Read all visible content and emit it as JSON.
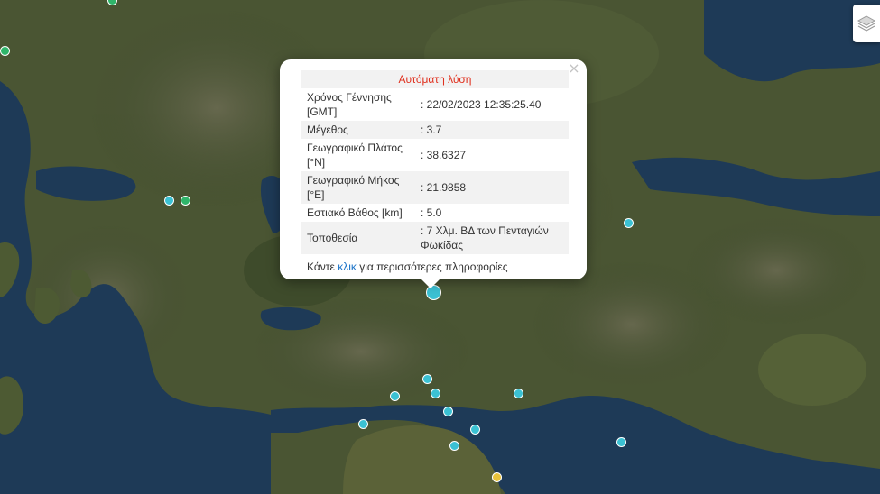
{
  "map": {
    "markers": [
      {
        "kind": "selected",
        "color": "#3bc1d3"
      },
      {
        "kind": "event",
        "color": "#3bc1d3"
      },
      {
        "kind": "event",
        "color": "#3bc1d3"
      },
      {
        "kind": "event",
        "color": "#3bc1d3"
      },
      {
        "kind": "event",
        "color": "#3bc1d3"
      },
      {
        "kind": "event",
        "color": "#3bc1d3"
      },
      {
        "kind": "event",
        "color": "#3bc1d3"
      },
      {
        "kind": "event",
        "color": "#3bc1d3"
      },
      {
        "kind": "event",
        "color": "#3bc1d3"
      },
      {
        "kind": "event",
        "color": "#3bc1d3"
      },
      {
        "kind": "event",
        "color": "#3bc1d3"
      },
      {
        "kind": "event",
        "color": "#3bc1d3"
      },
      {
        "kind": "event-older",
        "color": "#2fb56a"
      },
      {
        "kind": "event-older",
        "color": "#2fb56a"
      },
      {
        "kind": "event-older",
        "color": "#2fb56a"
      },
      {
        "kind": "event-recent",
        "color": "#e8c23a"
      }
    ],
    "layers_icon": "layers-icon"
  },
  "popup": {
    "title": "Αυτόματη λύση",
    "close_icon": "×",
    "rows": [
      {
        "label": "Χρόνος Γέννησης [GMT]",
        "value": ": 22/02/2023 12:35:25.40"
      },
      {
        "label": "Μέγεθος",
        "value": ": 3.7"
      },
      {
        "label": "Γεωγραφικό Πλάτος [°N]",
        "value": ": 38.6327"
      },
      {
        "label": "Γεωγραφικό Μήκος [°E]",
        "value": ": 21.9858"
      },
      {
        "label": "Εστιακό Βάθος [km]",
        "value": ": 5.0"
      },
      {
        "label": "Τοποθεσία",
        "value": ": 7 Χλμ. ΒΔ των Πενταγιών Φωκίδας"
      }
    ],
    "footer_before": "Κάντε ",
    "footer_link": "κλικ",
    "footer_after": " για περισσότερες πληροφορίες"
  }
}
